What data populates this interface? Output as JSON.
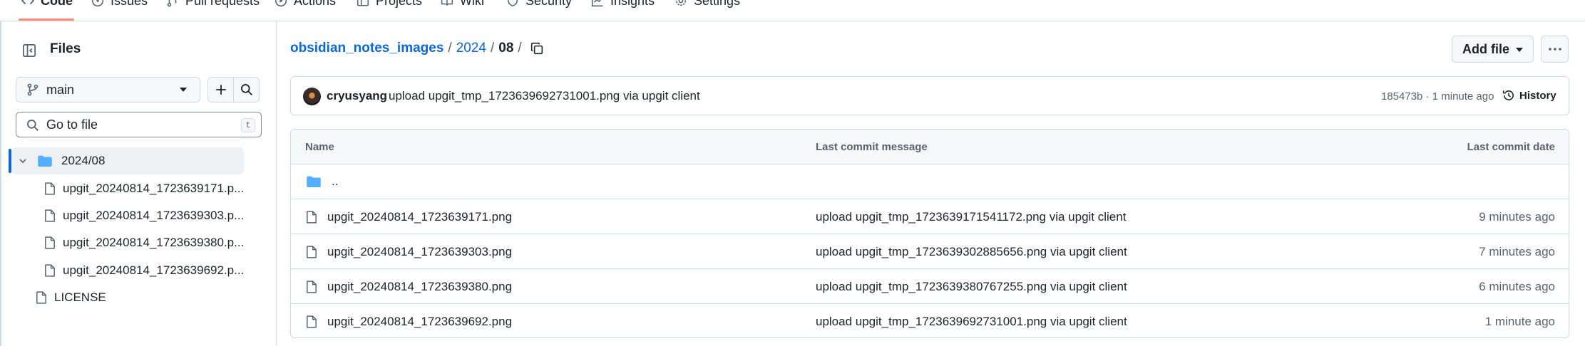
{
  "nav": {
    "tabs": [
      {
        "label": "Code",
        "icon": "code-icon"
      },
      {
        "label": "Issues",
        "icon": "issue-icon"
      },
      {
        "label": "Pull requests",
        "icon": "pull-request-icon"
      },
      {
        "label": "Actions",
        "icon": "play-icon"
      },
      {
        "label": "Projects",
        "icon": "table-icon"
      },
      {
        "label": "Wiki",
        "icon": "book-icon"
      },
      {
        "label": "Security",
        "icon": "shield-icon"
      },
      {
        "label": "Insights",
        "icon": "graph-icon"
      },
      {
        "label": "Settings",
        "icon": "gear-icon"
      }
    ]
  },
  "sidebar": {
    "title": "Files",
    "branch": "main",
    "goto_placeholder": "Go to file",
    "goto_shortcut": "t",
    "tree": {
      "folder": "2024/08",
      "files": [
        "upgit_20240814_1723639171.p...",
        "upgit_20240814_1723639303.p...",
        "upgit_20240814_1723639380.p...",
        "upgit_20240814_1723639692.p..."
      ],
      "root_files": [
        "LICENSE"
      ]
    }
  },
  "breadcrumb": {
    "repo": "obsidian_notes_images",
    "sep1": "/",
    "part1": "2024",
    "sep2": "/",
    "current": "08",
    "sep3": "/"
  },
  "actions": {
    "add_file": "Add file"
  },
  "commit": {
    "author": "cryusyang",
    "message": "upload upgit_tmp_1723639692731001.png via upgit client",
    "meta": "185473b · 1 minute ago",
    "history": "History"
  },
  "table": {
    "headers": {
      "name": "Name",
      "message": "Last commit message",
      "date": "Last commit date"
    },
    "parent": "..",
    "rows": [
      {
        "name": "upgit_20240814_1723639171.png",
        "message": "upload upgit_tmp_1723639171541172.png via upgit client",
        "date": "9 minutes ago"
      },
      {
        "name": "upgit_20240814_1723639303.png",
        "message": "upload upgit_tmp_1723639302885656.png via upgit client",
        "date": "7 minutes ago"
      },
      {
        "name": "upgit_20240814_1723639380.png",
        "message": "upload upgit_tmp_1723639380767255.png via upgit client",
        "date": "6 minutes ago"
      },
      {
        "name": "upgit_20240814_1723639692.png",
        "message": "upload upgit_tmp_1723639692731001.png via upgit client",
        "date": "1 minute ago"
      }
    ]
  },
  "colors": {
    "accent": "#0969da",
    "tab_underline": "#fd8c73",
    "folder": "#54aeff",
    "border": "#d1d9e0"
  }
}
